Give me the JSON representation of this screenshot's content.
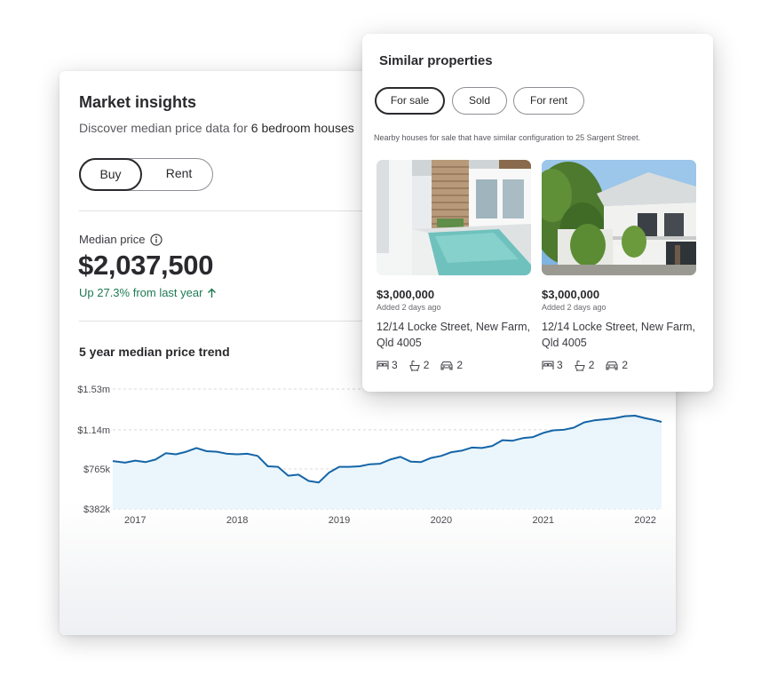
{
  "market_insights": {
    "title": "Market insights",
    "subtitle_prefix": "Discover median price data for ",
    "subtitle_highlight": "6 bedroom houses",
    "toggle": {
      "buy_label": "Buy",
      "rent_label": "Rent",
      "selected": "Buy"
    },
    "median_price": {
      "label": "Median price",
      "value": "$2,037,500",
      "change_text": "Up 27.3% from last year",
      "change_color": "#1f7a55"
    },
    "trend_title": "5 year median price trend"
  },
  "chart_data": {
    "type": "area",
    "title": "5 year median price trend",
    "y_tick_labels": [
      "$1.53m",
      "$1.14m",
      "$765k",
      "$382k"
    ],
    "y_ticks": [
      1530,
      1140,
      765,
      382
    ],
    "ylim": [
      382,
      1530
    ],
    "x_tick_labels": [
      "2017",
      "2018",
      "2019",
      "2020",
      "2021",
      "2022"
    ],
    "x_ticks": [
      2017,
      2018,
      2019,
      2020,
      2021,
      2022
    ],
    "xlim": [
      2016.78,
      2022.16
    ],
    "grid": true,
    "line_color": "#1565a8",
    "fill_color": "#eaf6fb",
    "x": [
      2016.78,
      2016.9,
      2017.0,
      2017.1,
      2017.2,
      2017.3,
      2017.4,
      2017.5,
      2017.6,
      2017.7,
      2017.8,
      2017.9,
      2018.0,
      2018.1,
      2018.2,
      2018.3,
      2018.4,
      2018.5,
      2018.6,
      2018.7,
      2018.8,
      2018.9,
      2019.0,
      2019.1,
      2019.2,
      2019.3,
      2019.4,
      2019.5,
      2019.6,
      2019.7,
      2019.8,
      2019.9,
      2020.0,
      2020.1,
      2020.2,
      2020.3,
      2020.4,
      2020.5,
      2020.6,
      2020.7,
      2020.8,
      2020.9,
      2021.0,
      2021.1,
      2021.2,
      2021.3,
      2021.4,
      2021.5,
      2021.6,
      2021.7,
      2021.8,
      2021.9,
      2022.0,
      2022.08,
      2022.16
    ],
    "y": [
      840,
      825,
      845,
      830,
      855,
      915,
      905,
      930,
      965,
      935,
      930,
      910,
      905,
      910,
      890,
      790,
      785,
      700,
      710,
      650,
      635,
      730,
      785,
      785,
      790,
      810,
      815,
      855,
      880,
      835,
      830,
      870,
      890,
      925,
      940,
      970,
      965,
      985,
      1040,
      1035,
      1060,
      1070,
      1110,
      1135,
      1140,
      1160,
      1210,
      1230,
      1240,
      1250,
      1270,
      1275,
      1250,
      1235,
      1215
    ]
  },
  "similar_properties": {
    "title": "Similar properties",
    "tabs": [
      {
        "label": "For sale",
        "selected": true
      },
      {
        "label": "Sold",
        "selected": false
      },
      {
        "label": "For rent",
        "selected": false
      }
    ],
    "description": "Nearby houses for sale that have similar configuration to 25 Sargent Street.",
    "listings": [
      {
        "image": "modern-house-pool-photo",
        "price": "$3,000,000",
        "added": "Added 2 days ago",
        "address": "12/14 Locke Street, New Farm, Qld 4005",
        "beds": "3",
        "baths": "2",
        "cars": "2"
      },
      {
        "image": "queenslander-house-photo",
        "price": "$3,000,000",
        "added": "Added 2 days ago",
        "address": "12/14 Locke Street, New Farm, Qld 4005",
        "beds": "3",
        "baths": "2",
        "cars": "2"
      }
    ]
  }
}
